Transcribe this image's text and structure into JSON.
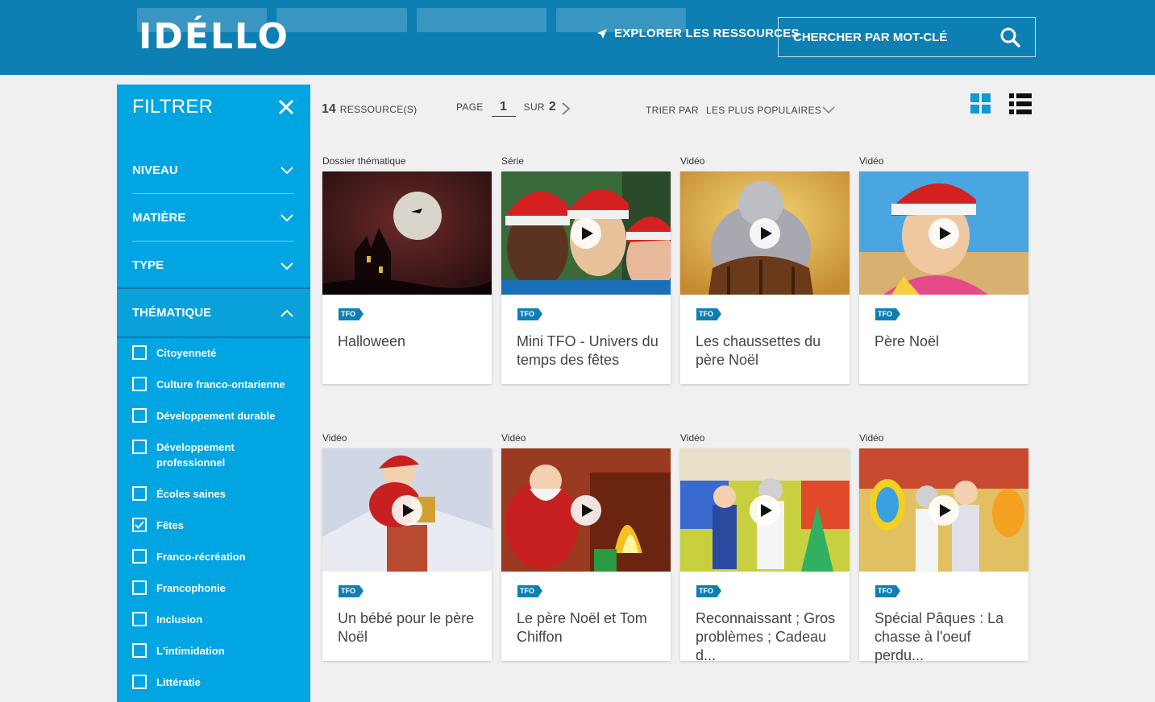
{
  "header": {
    "logo": "IDÉLLO",
    "explore_label": "EXPLORER LES RESSOURCES",
    "search_placeholder": "CHERCHER PAR MOT-CLÉ"
  },
  "sidebar": {
    "title": "FILTRER",
    "sections": [
      {
        "label": "NIVEAU",
        "open": false
      },
      {
        "label": "MATIÈRE",
        "open": false
      },
      {
        "label": "TYPE",
        "open": false
      },
      {
        "label": "THÉMATIQUE",
        "open": true
      }
    ],
    "themes": [
      {
        "label": "Citoyenneté",
        "checked": false
      },
      {
        "label": "Culture franco-ontarienne",
        "checked": false
      },
      {
        "label": "Développement durable",
        "checked": false
      },
      {
        "label": "Développement professionnel",
        "checked": false
      },
      {
        "label": "Écoles saines",
        "checked": false
      },
      {
        "label": "Fêtes",
        "checked": true
      },
      {
        "label": "Franco-récréation",
        "checked": false
      },
      {
        "label": "Francophonie",
        "checked": false
      },
      {
        "label": "Inclusion",
        "checked": false
      },
      {
        "label": "L'intimidation",
        "checked": false
      },
      {
        "label": "Littératie",
        "checked": false
      }
    ]
  },
  "toolbar": {
    "count": "14",
    "count_label": "RESSOURCE(S)",
    "page_label": "PAGE",
    "page_current": "1",
    "page_of": "SUR",
    "page_total": "2",
    "sort_label": "TRIER PAR",
    "sort_value": "LES PLUS POPULAIRES"
  },
  "cards": [
    {
      "type": "Dossier thématique",
      "title": "Halloween",
      "badge": "TFO",
      "has_play": false,
      "thumb": "halloween-moon"
    },
    {
      "type": "Série",
      "title": "Mini TFO - Univers du temps des fêtes",
      "badge": "TFO",
      "has_play": true,
      "thumb": "santa-hats-hosts"
    },
    {
      "type": "Vidéo",
      "title": "Les chaussettes du père Noël",
      "badge": "TFO",
      "has_play": true,
      "thumb": "animated-chair"
    },
    {
      "type": "Vidéo",
      "title": "Père Noël",
      "badge": "TFO",
      "has_play": true,
      "thumb": "host-santa-hat"
    },
    {
      "type": "Vidéo",
      "title": "Un bébé pour le père Noël",
      "badge": "TFO",
      "has_play": true,
      "thumb": "santa-chimney"
    },
    {
      "type": "Vidéo",
      "title": "Le père Noël et Tom Chiffon",
      "badge": "TFO",
      "has_play": true,
      "thumb": "santa-fireplace"
    },
    {
      "type": "Vidéo",
      "title": "Reconnaissant ; Gros problèmes ; Cadeau d...",
      "badge": "TFO",
      "has_play": true,
      "thumb": "kids-show-set"
    },
    {
      "type": "Vidéo",
      "title": "Spécial Pâques : La chasse à l'oeuf perdu...",
      "badge": "TFO",
      "has_play": true,
      "thumb": "easter-set"
    }
  ],
  "colors": {
    "header_bg": "#0e7fb3",
    "sidebar_bg": "#00a5e1",
    "accent": "#0e7fb3",
    "page_bg": "#f0f0f0"
  }
}
